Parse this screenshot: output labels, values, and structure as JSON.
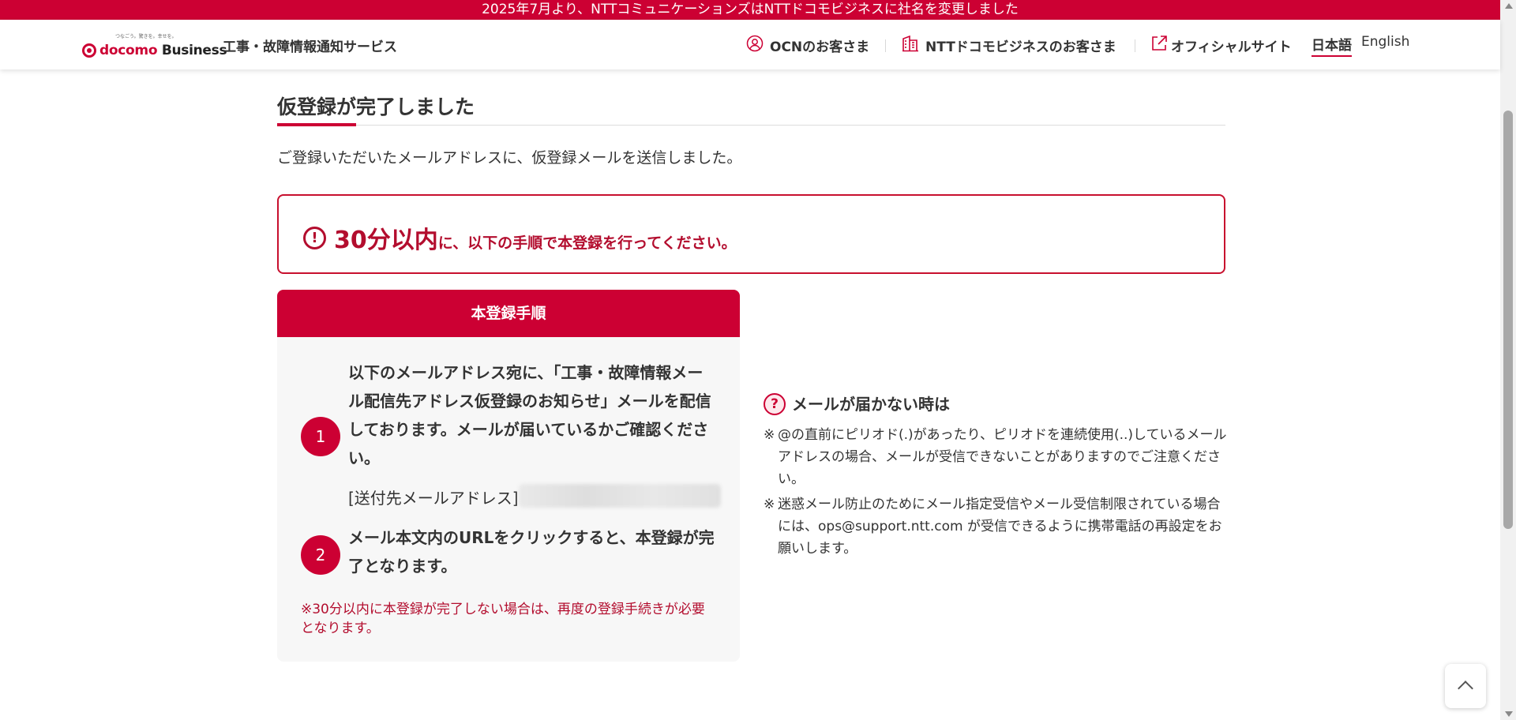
{
  "banner": {
    "text": "2025年7月より、NTTコミュニケーションズはNTTドコモビジネスに社名を変更しました"
  },
  "header": {
    "logo_tagline": "つなごう。驚きを。幸せを。",
    "logo_docomo": "docomo",
    "logo_business": "Business",
    "service_name": "工事・故障情報通知サービス",
    "nav": {
      "ocn": "OCNのお客さま",
      "ntt_docomo_business": "NTTドコモビジネスのお客さま",
      "official_site": "オフィシャルサイト"
    },
    "lang": {
      "ja": "日本語",
      "en": "English"
    }
  },
  "main": {
    "title": "仮登録が完了しました",
    "lead": "ご登録いただいたメールアドレスに、仮登録メールを送信しました。",
    "alert": {
      "icon": "!",
      "emphasis": "30分以内",
      "rest": "に、以下の手順で本登録を行ってください。"
    },
    "steps": {
      "heading": "本登録手順",
      "items": [
        {
          "num": "1",
          "text": "以下のメールアドレス宛に、「工事・故障情報メール配信先アドレス仮登録のお知らせ」メールを配信しております。メールが届いているかご確認ください。"
        },
        {
          "num": "2",
          "text": "メール本文内のURLをクリックすると、本登録が完了となります。"
        }
      ],
      "address_label": "[送付先メールアドレス]",
      "note": "※30分以内に本登録が完了しない場合は、再度の登録手続きが必要となります。"
    },
    "help": {
      "icon": "?",
      "title": "メールが届かない時は",
      "items": [
        {
          "mark": "※",
          "text": "@の直前にピリオド(.)があったり、ピリオドを連続使用(..)しているメールアドレスの場合、メールが受信できないことがありますのでご注意ください。"
        },
        {
          "mark": "※",
          "text": "迷惑メール防止のためにメール指定受信やメール受信制限されている場合には、ops@support.ntt.com が受信できるように携帯電話の再設定をお願いします。"
        }
      ]
    }
  },
  "icons": [
    "user-icon",
    "building-icon",
    "external-link-icon",
    "alert-icon",
    "help-icon",
    "chevron-up-icon"
  ],
  "colors": {
    "brand_red": "#cc0033",
    "alert_red": "#b30d2e",
    "panel_bg": "#f7f7f7"
  }
}
